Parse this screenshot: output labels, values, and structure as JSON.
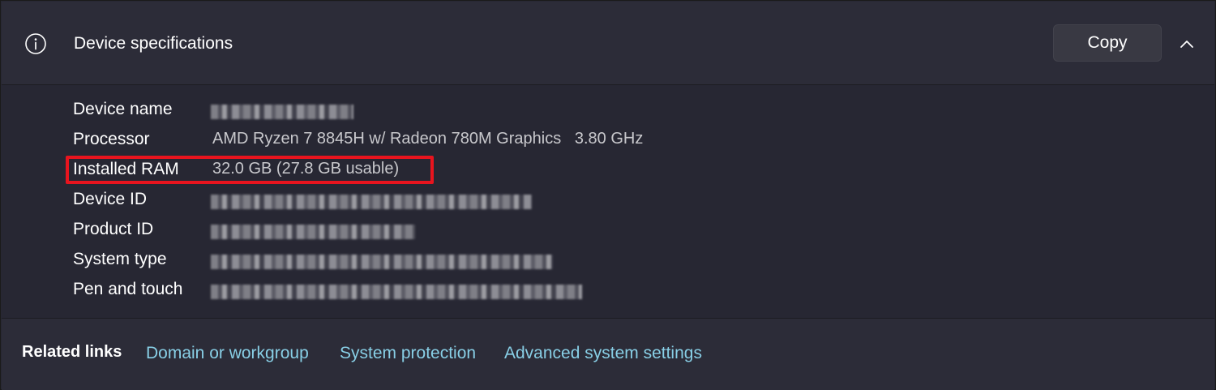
{
  "header": {
    "title": "Device specifications",
    "copy_label": "Copy",
    "icon": "info-icon",
    "collapse_icon": "chevron-up-icon"
  },
  "specs": [
    {
      "label": "Device name",
      "value": "",
      "redacted": true
    },
    {
      "label": "Processor",
      "value": "AMD Ryzen 7 8845H w/ Radeon 780M Graphics   3.80 GHz",
      "redacted": false
    },
    {
      "label": "Installed RAM",
      "value": "32.0 GB (27.8 GB usable)",
      "redacted": false,
      "highlighted": true
    },
    {
      "label": "Device ID",
      "value": "",
      "redacted": true
    },
    {
      "label": "Product ID",
      "value": "",
      "redacted": true
    },
    {
      "label": "System type",
      "value": "",
      "redacted": true
    },
    {
      "label": "Pen and touch",
      "value": "",
      "redacted": true
    }
  ],
  "related": {
    "title": "Related links",
    "links": [
      "Domain or workgroup",
      "System protection",
      "Advanced system settings"
    ]
  },
  "colors": {
    "accent_link": "#88cfe6",
    "highlight": "#e8141e",
    "background": "#272733"
  }
}
